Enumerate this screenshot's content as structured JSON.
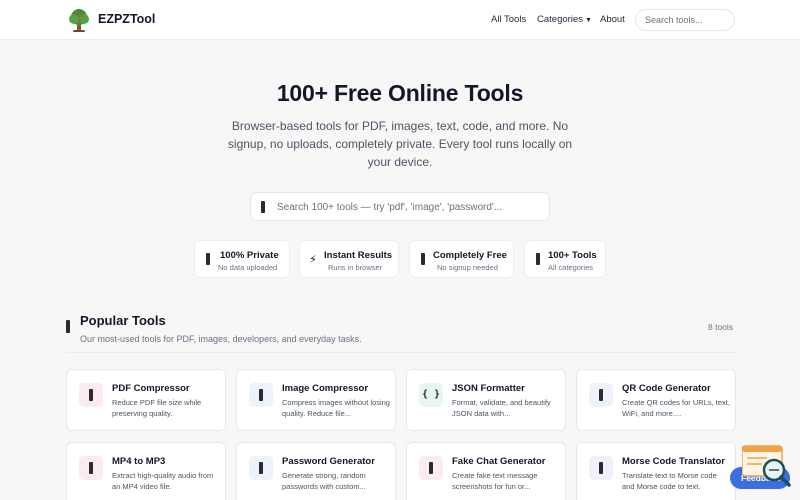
{
  "header": {
    "brand": "EZPZTool",
    "nav": {
      "all_tools": "All Tools",
      "categories": "Categories",
      "categories_caret": "▼",
      "about": "About"
    },
    "search_placeholder": "Search tools..."
  },
  "hero": {
    "title": "100+ Free Online Tools",
    "subtitle": "Browser-based tools for PDF, images, text, code, and more. No signup, no uploads, completely private. Every tool runs locally on your device.",
    "search_placeholder": "Search 100+ tools — try 'pdf', 'image', 'password'..."
  },
  "features": [
    {
      "icon": "bar-icon",
      "title": "100% Private",
      "subtitle": "No data uploaded"
    },
    {
      "icon": "lightning-icon",
      "glyph": "⚡",
      "title": "Instant Results",
      "subtitle": "Runs in browser"
    },
    {
      "icon": "bar-icon",
      "title": "Completely Free",
      "subtitle": "No signup needed"
    },
    {
      "icon": "bar-icon",
      "title": "100+ Tools",
      "subtitle": "All categories"
    }
  ],
  "popular": {
    "title": "Popular Tools",
    "subtitle": "Our most-used tools for PDF, images, developers, and everyday tasks.",
    "count": "8 tools",
    "tools": [
      {
        "title": "PDF Compressor",
        "desc": "Reduce PDF file size while preserving quality.",
        "icon": "pdf-icon"
      },
      {
        "title": "Image Compressor",
        "desc": "Compress images without losing quality. Reduce file...",
        "icon": "image-icon"
      },
      {
        "title": "JSON Formatter",
        "desc": "Format, validate, and beautify JSON data with...",
        "icon": "braces-icon",
        "glyph": "{ }"
      },
      {
        "title": "QR Code Generator",
        "desc": "Create QR codes for URLs, text, WiFi, and more....",
        "icon": "qr-icon"
      },
      {
        "title": "MP4 to MP3",
        "desc": "Extract high-quality audio from an MP4 video file.",
        "icon": "audio-icon"
      },
      {
        "title": "Password Generator",
        "desc": "Generate strong, random passwords with custom...",
        "icon": "key-icon"
      },
      {
        "title": "Fake Chat Generator",
        "desc": "Create fake text message screenshots for fun or...",
        "icon": "chat-icon"
      },
      {
        "title": "Morse Code Translator",
        "desc": "Translate text to Morse code and Morse code to text.",
        "icon": "morse-icon"
      }
    ]
  },
  "feedback": {
    "label": "Feedback"
  },
  "colors": {
    "accent": "#3b6fe0",
    "pink": "#fdecef",
    "green": "#eaf7ef",
    "blue": "#eef2fb",
    "lavender": "#f1effa"
  }
}
